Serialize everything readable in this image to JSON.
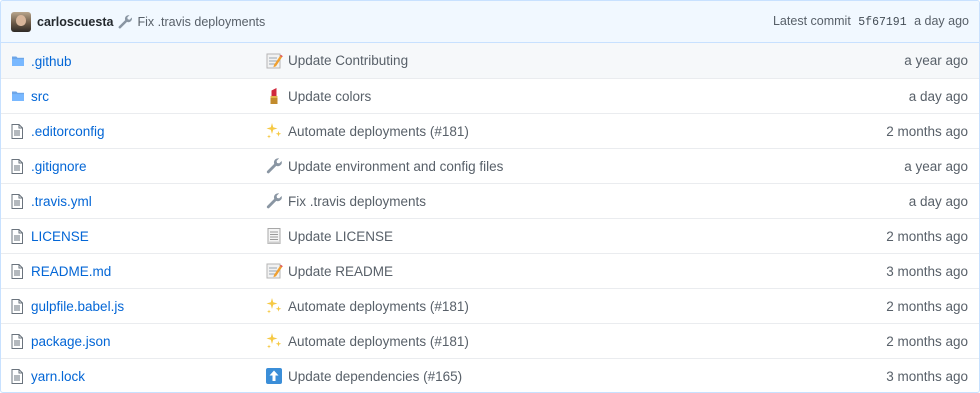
{
  "latest_commit": {
    "author": "carloscuesta",
    "message": "Fix .travis deployments",
    "prefix": "Latest commit",
    "sha": "5f67191",
    "age": "a day ago"
  },
  "files": [
    {
      "type": "folder",
      "name": ".github",
      "emoji": "memo",
      "message": "Update Contributing",
      "age": "a year ago"
    },
    {
      "type": "folder",
      "name": "src",
      "emoji": "lipstick",
      "message": "Update colors",
      "age": "a day ago"
    },
    {
      "type": "file",
      "name": ".editorconfig",
      "emoji": "sparkles",
      "message": "Automate deployments (#181)",
      "age": "2 months ago"
    },
    {
      "type": "file",
      "name": ".gitignore",
      "emoji": "wrench",
      "message": "Update environment and config files",
      "age": "a year ago"
    },
    {
      "type": "file",
      "name": ".travis.yml",
      "emoji": "wrench",
      "message": "Fix .travis deployments",
      "age": "a day ago"
    },
    {
      "type": "file",
      "name": "LICENSE",
      "emoji": "page",
      "message": "Update LICENSE",
      "age": "2 months ago"
    },
    {
      "type": "file",
      "name": "README.md",
      "emoji": "memo",
      "message": "Update README",
      "age": "3 months ago"
    },
    {
      "type": "file",
      "name": "gulpfile.babel.js",
      "emoji": "sparkles",
      "message": "Automate deployments (#181)",
      "age": "2 months ago"
    },
    {
      "type": "file",
      "name": "package.json",
      "emoji": "sparkles",
      "message": "Automate deployments (#181)",
      "age": "2 months ago"
    },
    {
      "type": "file",
      "name": "yarn.lock",
      "emoji": "arrow-up",
      "message": "Update dependencies (#165)",
      "age": "3 months ago"
    }
  ],
  "colors": {
    "link": "#0366d6",
    "muted": "#586069",
    "folder": "#79b8ff",
    "commit_bar_bg": "#f1f8ff",
    "commit_bar_border": "#c8e1ff"
  }
}
